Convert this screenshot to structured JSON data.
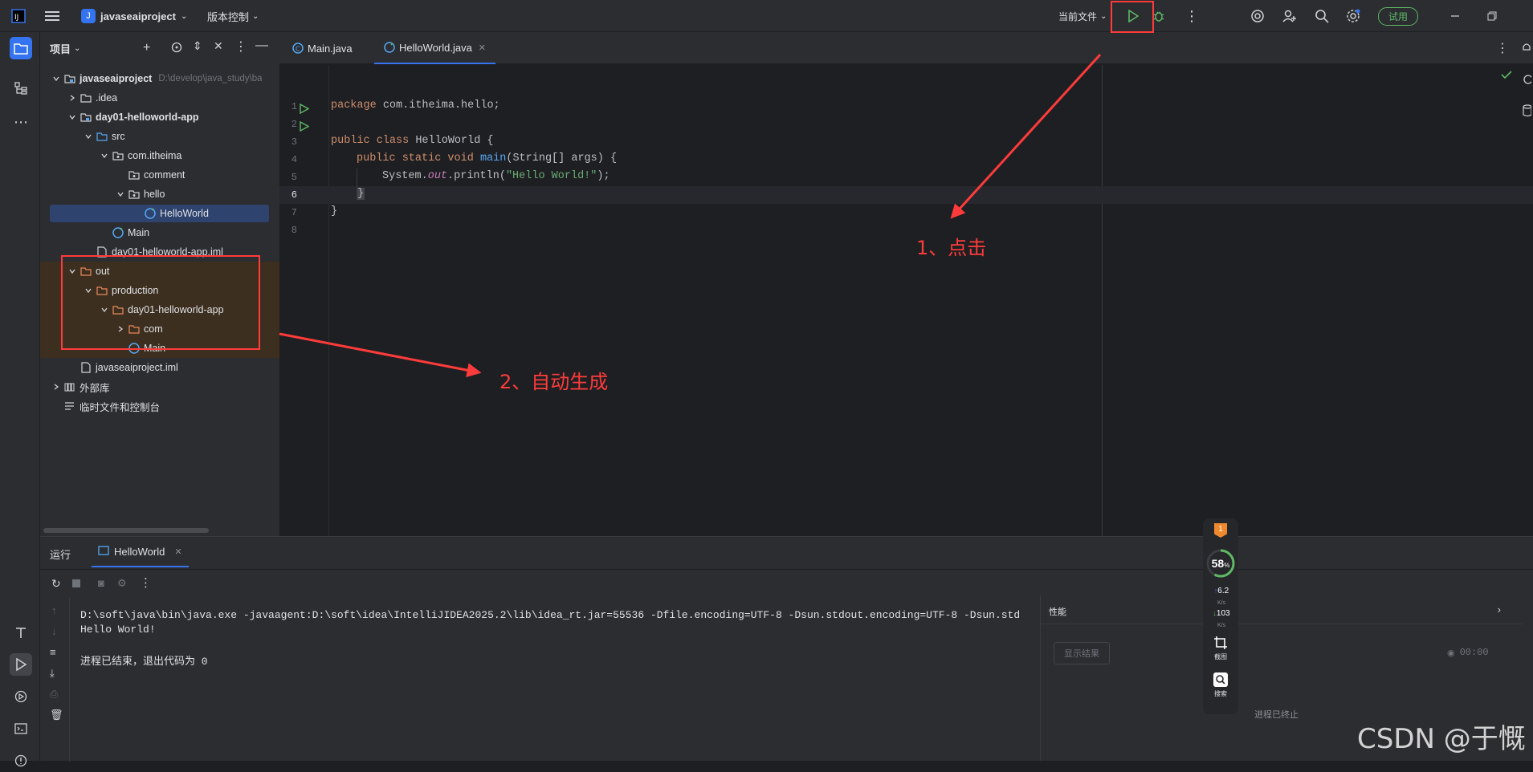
{
  "titlebar": {
    "project_initial": "J",
    "project_name": "javaseaiproject",
    "vcs_label": "版本控制",
    "run_config": "当前文件",
    "trial_button": "试用"
  },
  "project_panel": {
    "title": "项目",
    "tree": [
      {
        "label": "javaseaiproject",
        "hint": "D:\\develop\\java_study\\ba",
        "bold": true,
        "expanded": true,
        "icon": "module-folder-icon"
      },
      {
        "label": ".idea",
        "expanded": false,
        "icon": "folder-icon"
      },
      {
        "label": "day01-helloworld-app",
        "bold": true,
        "expanded": true,
        "icon": "module-folder-icon"
      },
      {
        "label": "src",
        "expanded": true,
        "icon": "source-folder-icon"
      },
      {
        "label": "com.itheima",
        "expanded": true,
        "icon": "package-icon"
      },
      {
        "label": "comment",
        "icon": "package-icon"
      },
      {
        "label": "hello",
        "expanded": true,
        "icon": "package-icon"
      },
      {
        "label": "HelloWorld",
        "selected": true,
        "icon": "java-class-icon"
      },
      {
        "label": "Main",
        "icon": "java-class-icon"
      },
      {
        "label": "day01-helloworld-app.iml",
        "icon": "iml-file-icon"
      },
      {
        "label": "out",
        "expanded": true,
        "icon": "excluded-folder-icon"
      },
      {
        "label": "production",
        "expanded": true,
        "icon": "excluded-folder-icon"
      },
      {
        "label": "day01-helloworld-app",
        "expanded": true,
        "icon": "excluded-folder-icon"
      },
      {
        "label": "com",
        "expanded": false,
        "icon": "excluded-folder-icon"
      },
      {
        "label": "Main",
        "icon": "class-file-icon"
      },
      {
        "label": "javaseaiproject.iml",
        "icon": "iml-file-icon"
      },
      {
        "label": "外部库",
        "expanded": false,
        "icon": "library-icon"
      },
      {
        "label": "临时文件和控制台",
        "icon": "scratch-icon"
      }
    ]
  },
  "editor": {
    "tabs": [
      {
        "label": "Main.java",
        "active": false
      },
      {
        "label": "HelloWorld.java",
        "active": true
      }
    ],
    "line_numbers": [
      "1",
      "2",
      "3",
      "4",
      "5",
      "6",
      "7",
      "8"
    ],
    "code": {
      "l1_kw": "package",
      "l1_rest": " com.itheima.hello;",
      "l3_kw": "public class",
      "l3_rest": " HelloWorld {",
      "l4_kw": "public static void",
      "l4_method": "main",
      "l4_rest": "(String[] args) {",
      "l5_pre": "System.",
      "l5_field": "out",
      "l5_mid": ".println(",
      "l5_str": "\"Hello World!\"",
      "l5_end": ");",
      "l6": "}",
      "l7": "}"
    }
  },
  "run_panel": {
    "title": "运行",
    "tab_label": "HelloWorld",
    "console": [
      "D:\\soft\\java\\bin\\java.exe -javaagent:D:\\soft\\idea\\IntelliJIDEA2025.2\\lib\\idea_rt.jar=55536 -Dfile.encoding=UTF-8 -Dsun.stdout.encoding=UTF-8 -Dsun.std",
      "Hello World!",
      "",
      "进程已结束，退出代码为 0"
    ]
  },
  "perf_panel": {
    "title": "性能",
    "show_results": "显示结果",
    "timer": "00:00",
    "status": "进程已终止"
  },
  "widget": {
    "badge": "1",
    "percent": "58",
    "percent_unit": "%",
    "up_speed": "6.2",
    "up_unit": "K/s",
    "down_speed": "103",
    "down_unit": "K/s",
    "screenshot_label": "截图",
    "search_label": "搜索"
  },
  "annotations": {
    "click_label": "1、点击",
    "auto_label": "2、自动生成"
  },
  "watermark": "CSDN @于慨",
  "colors": {
    "keyword": "#cf8e6d",
    "method": "#56a8f5",
    "string": "#6aab73",
    "field": "#c77dbb",
    "run_green": "#5fb865",
    "annotation_red": "#ff3b3b",
    "selection": "#2e436e",
    "excluded_bg": "#3d2f1f"
  }
}
